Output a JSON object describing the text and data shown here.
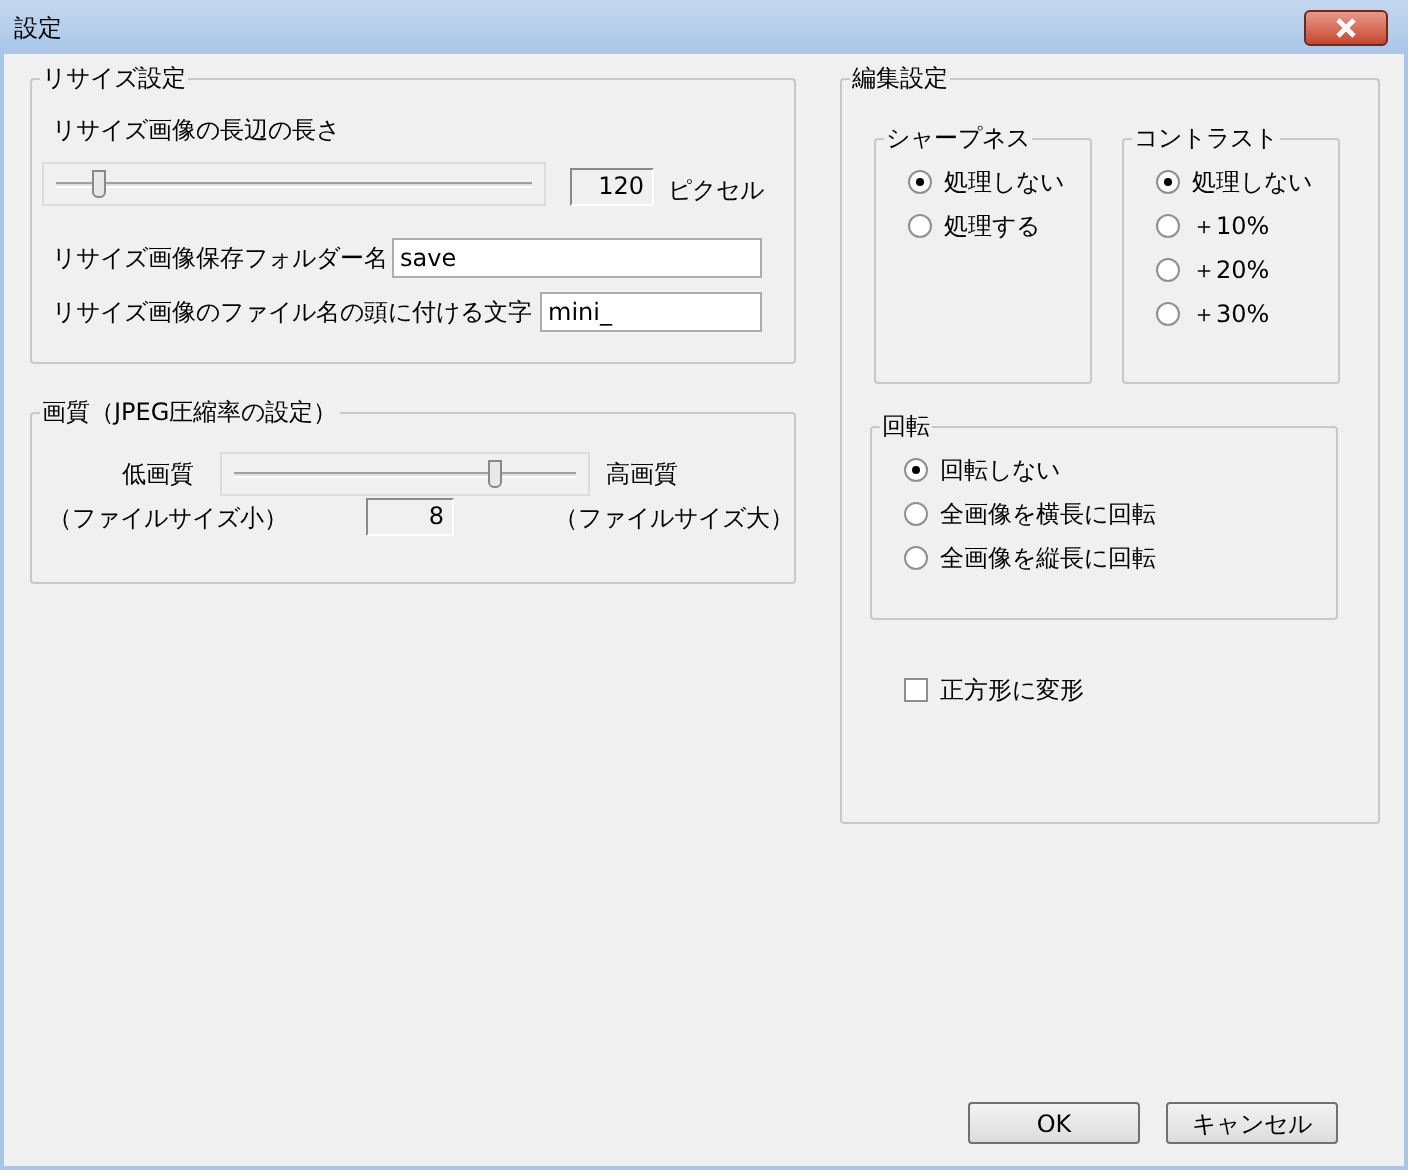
{
  "window": {
    "title": "設定"
  },
  "resize_group": {
    "title": "リサイズ設定",
    "length_label": "リサイズ画像の長辺の長さ",
    "length_slider": {
      "level": 0.08
    },
    "length_value": "120",
    "length_unit": "ピクセル",
    "folder_label": "リサイズ画像保存フォルダー名",
    "folder_value": "save",
    "prefix_label": "リサイズ画像のファイル名の頭に付ける文字",
    "prefix_value": "mini_"
  },
  "quality_group": {
    "title": "画質（JPEG圧縮率の設定）",
    "low_label": "低画質",
    "high_label": "高画質",
    "low_note": "（ファイルサイズ小）",
    "high_note": "（ファイルサイズ大）",
    "slider": {
      "level": 0.78
    },
    "value": "8"
  },
  "edit_group": {
    "title": "編集設定",
    "sharpness": {
      "title": "シャープネス",
      "options": [
        {
          "label": "処理しない",
          "selected": true
        },
        {
          "label": "処理する",
          "selected": false
        }
      ]
    },
    "contrast": {
      "title": "コントラスト",
      "options": [
        {
          "label": "処理しない",
          "selected": true
        },
        {
          "label": "＋10%",
          "selected": false
        },
        {
          "label": "＋20%",
          "selected": false
        },
        {
          "label": "＋30%",
          "selected": false
        }
      ]
    },
    "rotation": {
      "title": "回転",
      "options": [
        {
          "label": "回転しない",
          "selected": true
        },
        {
          "label": "全画像を横長に回転",
          "selected": false
        },
        {
          "label": "全画像を縦長に回転",
          "selected": false
        }
      ]
    },
    "square": {
      "label": "正方形に変形",
      "checked": false
    }
  },
  "buttons": [
    {
      "label": "OK"
    },
    {
      "label": "キャンセル"
    }
  ]
}
